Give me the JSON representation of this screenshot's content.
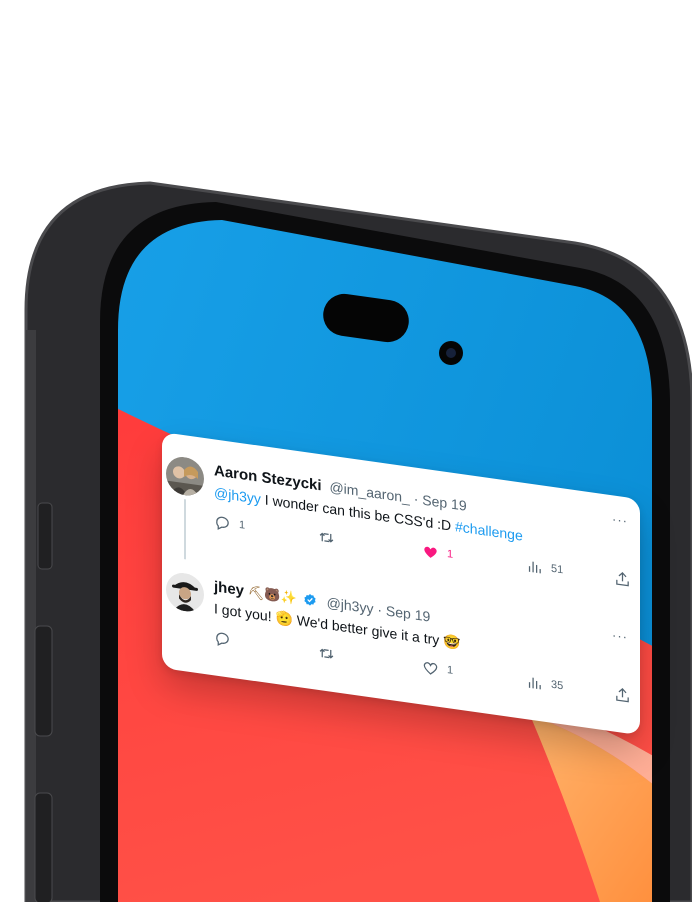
{
  "colors": {
    "frame": "#2a2a2c",
    "wallpaper_blue": "#1c9fe5",
    "wallpaper_red": "#ff4a3d",
    "link": "#1d9bf0",
    "like": "#f91880",
    "verified": "#1d9bf0"
  },
  "tweets": [
    {
      "name": "Aaron Stezycki",
      "handle": "@im_aaron_",
      "date": "· Sep 19",
      "mention": "@jh3yy",
      "text": " I wonder can this be CSS'd :D ",
      "hashtag": "#challenge",
      "replies": "1",
      "retweets": "",
      "likes": "1",
      "liked": true,
      "views": "51"
    },
    {
      "name": "jhey",
      "name_emoji": "⛏🐻✨",
      "verified": true,
      "handle": "@jh3yy",
      "date": "· Sep 19",
      "text": "I got you! 🫡 We'd better give it a try 🤓",
      "replies": "",
      "retweets": "",
      "likes": "1",
      "liked": false,
      "views": "35"
    }
  ],
  "icons": {
    "reply": "reply-icon",
    "retweet": "retweet-icon",
    "like": "heart-icon",
    "views": "views-icon",
    "share": "share-icon",
    "more": "more-icon"
  }
}
